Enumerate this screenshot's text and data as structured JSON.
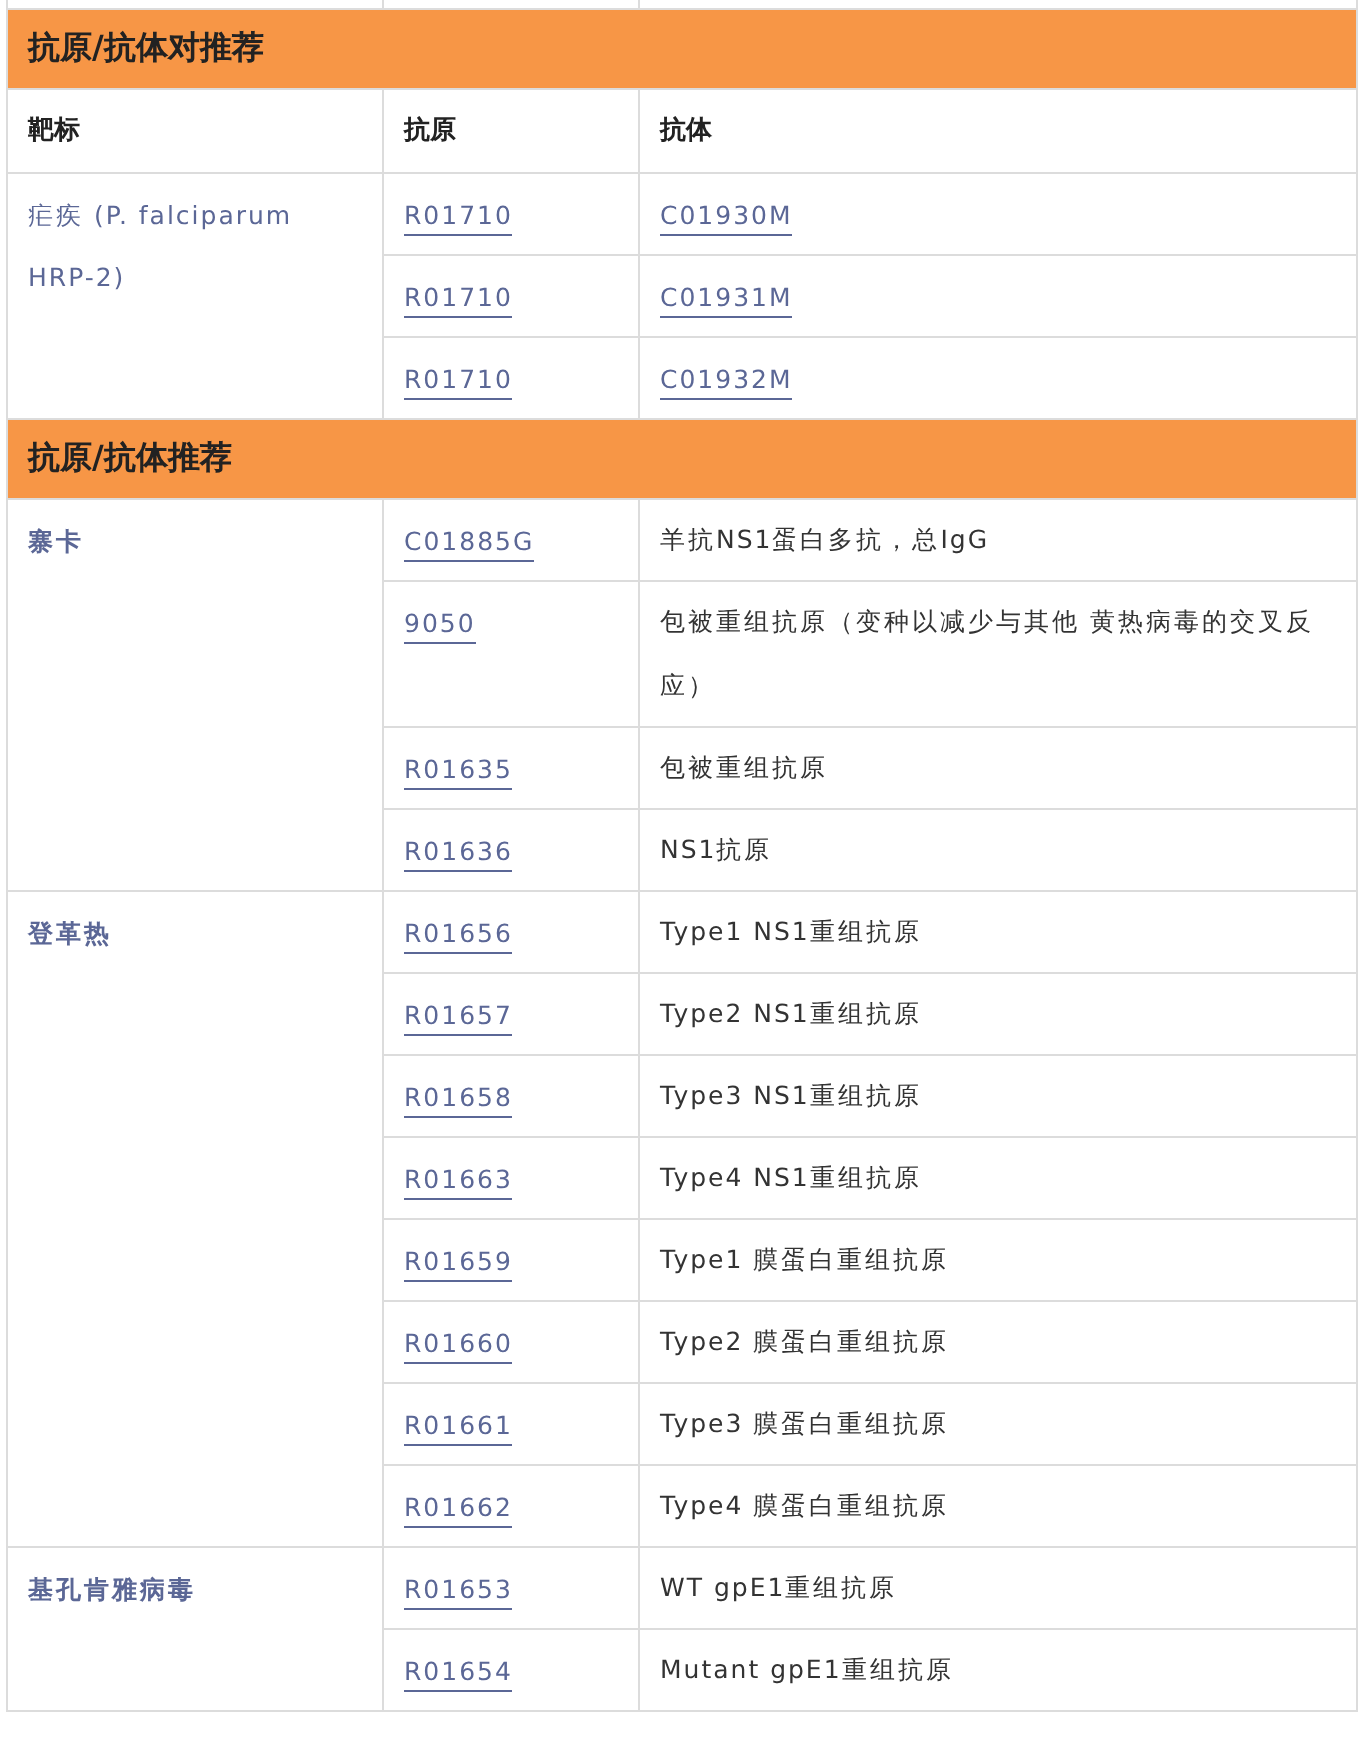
{
  "sections": [
    {
      "title": "抗原/抗体对推荐",
      "kind": "pairs",
      "columns": [
        "靶标",
        "抗原",
        "抗体"
      ],
      "groups": [
        {
          "target": "疟疾 (P. falciparum HRP-2)",
          "rows": [
            {
              "antigen": "R01710",
              "antibody": "C01930M"
            },
            {
              "antigen": "R01710",
              "antibody": "C01931M"
            },
            {
              "antigen": "R01710",
              "antibody": "C01932M"
            }
          ]
        }
      ]
    },
    {
      "title": "抗原/抗体推荐",
      "kind": "list",
      "groups": [
        {
          "target": "寨卡",
          "rows": [
            {
              "antigen": "C01885G",
              "description": "羊抗NS1蛋白多抗，总IgG"
            },
            {
              "antigen": "9050",
              "description": "包被重组抗原（变种以减少与其他 黄热病毒的交叉反应）"
            },
            {
              "antigen": "R01635",
              "description": "包被重组抗原"
            },
            {
              "antigen": "R01636",
              "description": "NS1抗原"
            }
          ]
        },
        {
          "target": "登革热",
          "rows": [
            {
              "antigen": "R01656",
              "description": "Type1 NS1重组抗原"
            },
            {
              "antigen": "R01657",
              "description": "Type2 NS1重组抗原"
            },
            {
              "antigen": "R01658",
              "description": "Type3 NS1重组抗原"
            },
            {
              "antigen": "R01663",
              "description": "Type4 NS1重组抗原"
            },
            {
              "antigen": "R01659",
              "description": "Type1 膜蛋白重组抗原"
            },
            {
              "antigen": "R01660",
              "description": "Type2 膜蛋白重组抗原"
            },
            {
              "antigen": "R01661",
              "description": "Type3 膜蛋白重组抗原"
            },
            {
              "antigen": "R01662",
              "description": "Type4 膜蛋白重组抗原"
            }
          ]
        },
        {
          "target": "基孔肯雅病毒",
          "rows": [
            {
              "antigen": "R01653",
              "description": "WT gpE1重组抗原"
            },
            {
              "antigen": "R01654",
              "description": "Mutant gpE1重组抗原"
            }
          ]
        }
      ]
    }
  ]
}
